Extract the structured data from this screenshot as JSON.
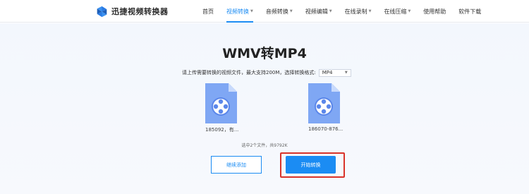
{
  "header": {
    "logo_text": "迅捷视频转换器",
    "nav": [
      {
        "label": "首页",
        "dropdown": false
      },
      {
        "label": "视频转换",
        "dropdown": true,
        "active": true
      },
      {
        "label": "音频转换",
        "dropdown": true
      },
      {
        "label": "视频编辑",
        "dropdown": true
      },
      {
        "label": "在线录制",
        "dropdown": true
      },
      {
        "label": "在线压缩",
        "dropdown": true
      },
      {
        "label": "使用帮助",
        "dropdown": false
      },
      {
        "label": "软件下载",
        "dropdown": false
      }
    ]
  },
  "main": {
    "title": "WMV转MP4",
    "description": "请上传需要转换的视频文件，最大支持200M，选择转换格式:",
    "format_selected": "MP4",
    "files": [
      {
        "name": "185092，有..."
      },
      {
        "name": "186070-876..."
      }
    ],
    "summary": "选中2个文件，共9792K",
    "add_button": "继续添加",
    "start_button": "开始转换"
  },
  "colors": {
    "accent": "#1b8cf3",
    "highlight_frame": "#d9332a",
    "file_icon": "#7fa7f4"
  }
}
